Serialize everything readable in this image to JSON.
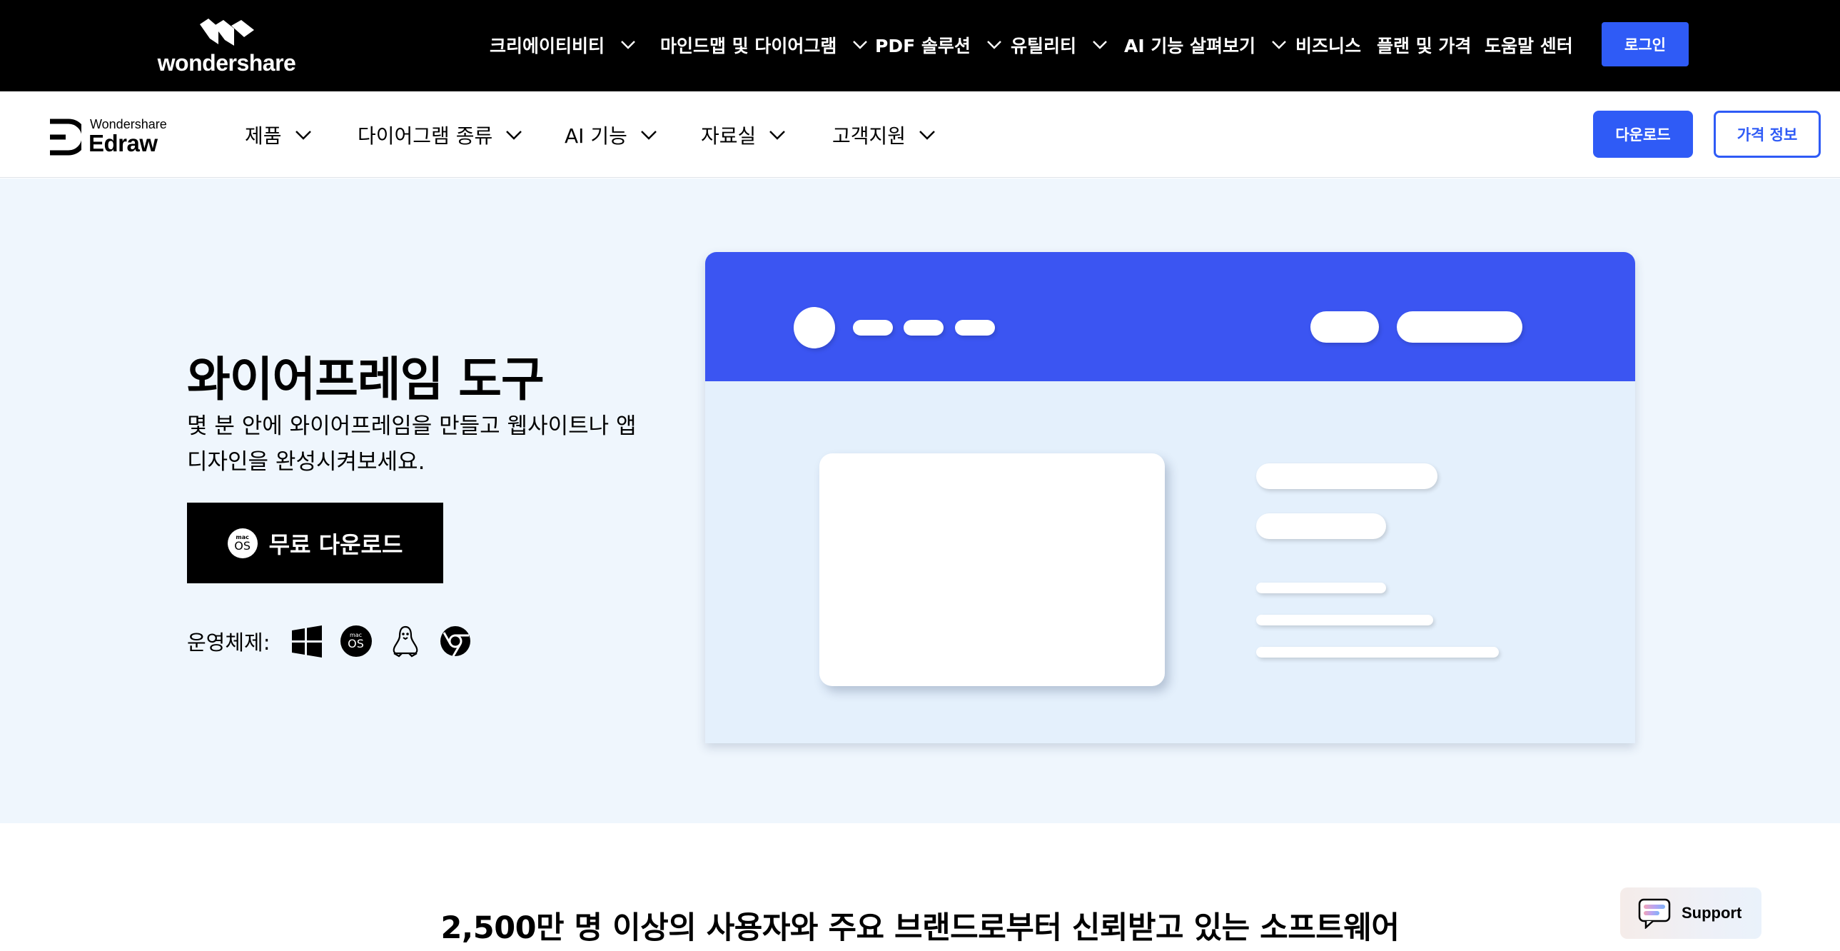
{
  "topbar": {
    "logo_text": "wondershare",
    "nav": [
      {
        "label": "크리에이티비티",
        "has_dropdown": true
      },
      {
        "label": "마인드맵 및 다이어그램",
        "has_dropdown": true
      },
      {
        "label": "PDF 솔루션",
        "has_dropdown": true
      },
      {
        "label": "유틸리티",
        "has_dropdown": true
      },
      {
        "label": "AI 기능 살펴보기",
        "has_dropdown": true
      },
      {
        "label": "비즈니스",
        "has_dropdown": false
      },
      {
        "label": "플랜 및 가격",
        "has_dropdown": false
      },
      {
        "label": "도움말 센터",
        "has_dropdown": false
      }
    ],
    "login_label": "로그인"
  },
  "subnav": {
    "logo_small": "Wondershare",
    "logo_big": "Edraw",
    "items": [
      {
        "label": "제품"
      },
      {
        "label": "다이어그램 종류"
      },
      {
        "label": "AI 기능"
      },
      {
        "label": "자료실"
      },
      {
        "label": "고객지원"
      }
    ],
    "download_label": "다운로드",
    "pricing_label": "가격 정보"
  },
  "hero": {
    "title": "와이어프레임 도구",
    "description": "몇 분 안에 와이어프레임을 만들고 웹사이트나 앱 디자인을 완성시켜보세요.",
    "cta_label": "무료 다운로드",
    "cta_icon_top": "mac",
    "cta_icon_bottom": "OS",
    "os_label": "운영체제:",
    "os_icons": [
      "windows-icon",
      "macos-icon",
      "linux-icon",
      "chrome-icon"
    ]
  },
  "trust": {
    "headline": "2,500만 명 이상의 사용자와 주요 브랜드로부터 신뢰받고 있는 소프트웨어"
  },
  "support": {
    "label": "Support"
  },
  "colors": {
    "brand_blue": "#2f5bf6",
    "illustration_blue": "#3b55f2",
    "hero_bg": "#eff6fd",
    "topbar_bg": "#000000"
  }
}
